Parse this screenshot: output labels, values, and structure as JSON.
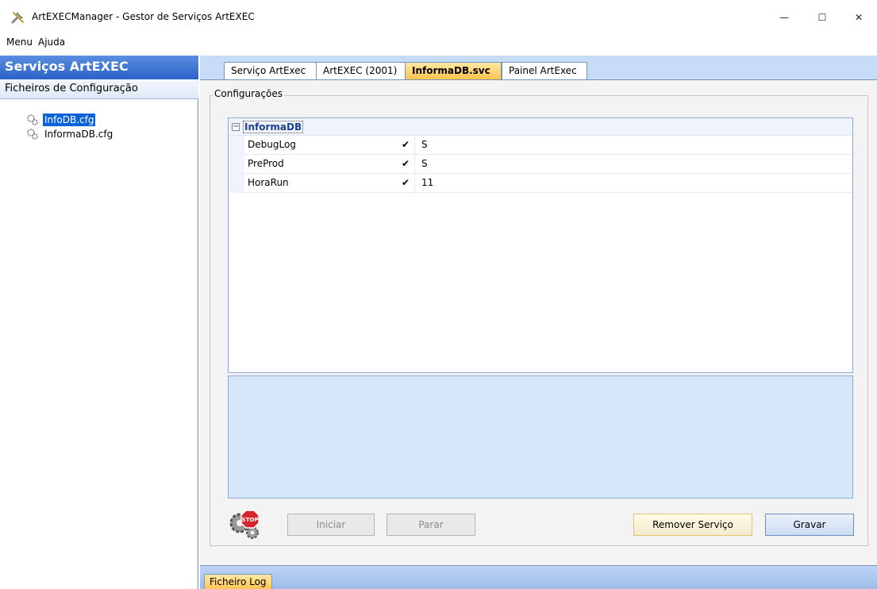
{
  "window": {
    "title": "ArtEXECManager - Gestor de Serviços ArtEXEC",
    "icon": "tools-icon",
    "controls": {
      "minimize": "—",
      "maximize": "☐",
      "close": "✕"
    }
  },
  "menubar": {
    "items": [
      "Menu",
      "Ajuda"
    ]
  },
  "left": {
    "header": "Serviços ArtEXEC",
    "subheader": "Ficheiros de Configuração",
    "tree": [
      {
        "label": "InfoDB.cfg",
        "selected": true,
        "icon": "gears-icon"
      },
      {
        "label": "InformaDB.cfg",
        "selected": false,
        "icon": "gears-icon"
      }
    ]
  },
  "tabs": [
    {
      "label": "Serviço ArtExec",
      "active": false
    },
    {
      "label": "ArtEXEC (2001)",
      "active": false
    },
    {
      "label": "InformaDB.svc",
      "active": true
    },
    {
      "label": "Painel ArtExec",
      "active": false
    }
  ],
  "config": {
    "legend": "Configurações",
    "category": "InformaDB",
    "expander": "−",
    "rows": [
      {
        "name": "DebugLog",
        "check": "✔",
        "value": "S"
      },
      {
        "name": "PreProd",
        "check": "✔",
        "value": "S"
      },
      {
        "name": "HoraRun",
        "check": "✔",
        "value": "11"
      }
    ]
  },
  "buttons": {
    "start": "Iniciar",
    "stop": "Parar",
    "remove": "Remover Serviço",
    "save": "Gravar",
    "status_icon": "gear-stop-icon",
    "stop_badge": "STOP"
  },
  "bottom_tabs": [
    {
      "label": "Ficheiro Log"
    }
  ],
  "colors": {
    "accent": "#2a62c9",
    "selection": "#0a64d8",
    "active_tab": "#ffc34d"
  }
}
